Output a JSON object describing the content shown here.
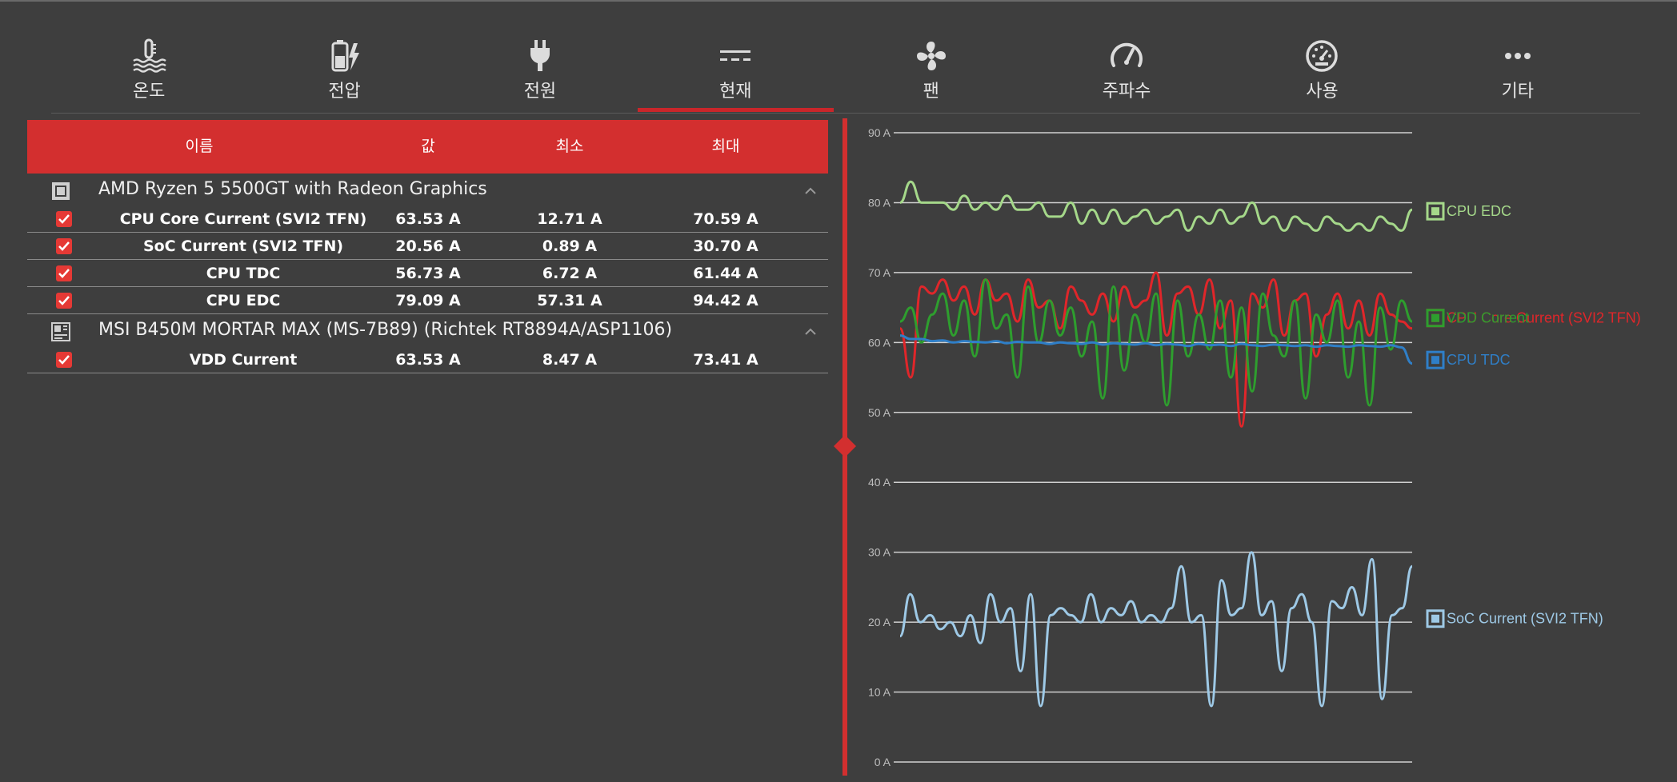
{
  "tabs": [
    {
      "label": "온도",
      "icon": "thermometer-icon",
      "active": false
    },
    {
      "label": "전압",
      "icon": "battery-bolt-icon",
      "active": false
    },
    {
      "label": "전원",
      "icon": "plug-icon",
      "active": false
    },
    {
      "label": "현재",
      "icon": "current-icon",
      "active": true
    },
    {
      "label": "팬",
      "icon": "fan-icon",
      "active": false
    },
    {
      "label": "주파수",
      "icon": "speedometer-icon",
      "active": false
    },
    {
      "label": "사용",
      "icon": "gauge-icon",
      "active": false
    },
    {
      "label": "기타",
      "icon": "more-icon",
      "active": false
    }
  ],
  "table": {
    "headers": {
      "name": "이름",
      "value": "값",
      "min": "최소",
      "max": "최대"
    },
    "groups": [
      {
        "name": "AMD Ryzen 5 5500GT with Radeon Graphics",
        "icon": "cpu-icon",
        "rows": [
          {
            "name": "CPU Core Current (SVI2 TFN)",
            "value": "63.53 A",
            "min": "12.71 A",
            "max": "70.59 A",
            "checked": true
          },
          {
            "name": "SoC Current (SVI2 TFN)",
            "value": "20.56 A",
            "min": "0.89 A",
            "max": "30.70 A",
            "checked": true
          },
          {
            "name": "CPU TDC",
            "value": "56.73 A",
            "min": "6.72 A",
            "max": "61.44 A",
            "checked": true
          },
          {
            "name": "CPU EDC",
            "value": "79.09 A",
            "min": "57.31 A",
            "max": "94.42 A",
            "checked": true
          }
        ]
      },
      {
        "name": "MSI B450M MORTAR MAX (MS-7B89) (Richtek RT8894A/ASP1106)",
        "icon": "motherboard-icon",
        "rows": [
          {
            "name": "VDD Current",
            "value": "63.53 A",
            "min": "8.47 A",
            "max": "73.41 A",
            "checked": true
          }
        ]
      }
    ]
  },
  "colors": {
    "accent": "#d32f2f",
    "background": "#3e3e3e",
    "cpu_edc": "#a5d88a",
    "cpu_core": "#e0262a",
    "vdd": "#2e9e2e",
    "cpu_tdc": "#2f7fc8",
    "soc": "#9ec9e6"
  },
  "chart_data": {
    "type": "line",
    "ylim": [
      0,
      90
    ],
    "yticks": [
      "0 A",
      "10 A",
      "20 A",
      "30 A",
      "40 A",
      "50 A",
      "60 A",
      "70 A",
      "80 A",
      "90 A"
    ],
    "grid": true,
    "legend": "right",
    "series": [
      {
        "name": "CPU EDC",
        "color": "#a5d88a",
        "values": [
          80,
          83,
          80,
          80,
          80,
          79,
          81,
          79,
          80,
          79,
          81,
          79,
          79,
          80,
          78,
          78,
          80,
          77,
          79,
          77,
          79,
          77,
          78,
          79,
          77,
          78,
          79,
          76,
          78,
          77,
          79,
          77,
          78,
          80,
          77,
          78,
          76,
          78,
          77,
          76,
          78,
          77,
          76,
          77,
          76,
          78,
          77,
          76,
          79
        ]
      },
      {
        "name": "CPU Core Current (SVI2 TFN)",
        "color": "#e0262a",
        "values": [
          62,
          55,
          68,
          67,
          69,
          66,
          68,
          64,
          69,
          66,
          67,
          63,
          69,
          65,
          66,
          62,
          68,
          66,
          64,
          67,
          63,
          68,
          65,
          66,
          70,
          61,
          67,
          68,
          64,
          69,
          62,
          66,
          48,
          67,
          65,
          69,
          61,
          66,
          67,
          58,
          64,
          67,
          62,
          66,
          61,
          67,
          64,
          63,
          62
        ]
      },
      {
        "name": "VDD Current",
        "color": "#2e9e2e",
        "values": [
          63,
          65,
          60,
          64,
          67,
          61,
          66,
          58,
          69,
          62,
          64,
          55,
          68,
          60,
          66,
          61,
          65,
          58,
          63,
          52,
          68,
          56,
          64,
          60,
          67,
          51,
          66,
          58,
          64,
          59,
          66,
          55,
          65,
          53,
          67,
          61,
          58,
          66,
          52,
          64,
          60,
          66,
          55,
          63,
          51,
          65,
          59,
          66,
          63
        ]
      },
      {
        "name": "CPU TDC",
        "color": "#2f7fc8",
        "values": [
          61,
          60.5,
          60.5,
          60.2,
          60.3,
          60,
          60.2,
          60.1,
          60,
          60.2,
          59.9,
          60.1,
          60,
          60,
          59.8,
          60,
          59.9,
          59.8,
          60,
          59.7,
          59.9,
          59.8,
          59.7,
          59.9,
          59.6,
          59.8,
          59.7,
          59.5,
          59.8,
          59.6,
          59.7,
          59.5,
          59.8,
          59.6,
          59.5,
          59.7,
          59.6,
          59.5,
          59.6,
          59.4,
          59.6,
          59.5,
          59.4,
          59.6,
          59.5,
          59.4,
          59.6,
          59.3,
          57
        ]
      },
      {
        "name": "SoC Current (SVI2 TFN)",
        "color": "#9ec9e6",
        "values": [
          18,
          24,
          20,
          21,
          19,
          20,
          18,
          21,
          17,
          24,
          20,
          22,
          13,
          24,
          8,
          21,
          22,
          21,
          20,
          24,
          20,
          22,
          21,
          23,
          20,
          21,
          20,
          22,
          28,
          20,
          21,
          8,
          26,
          21,
          22,
          30,
          21,
          23,
          13,
          22,
          24,
          20,
          8,
          23,
          22,
          25,
          21,
          29,
          9,
          21,
          22,
          28
        ]
      }
    ]
  }
}
